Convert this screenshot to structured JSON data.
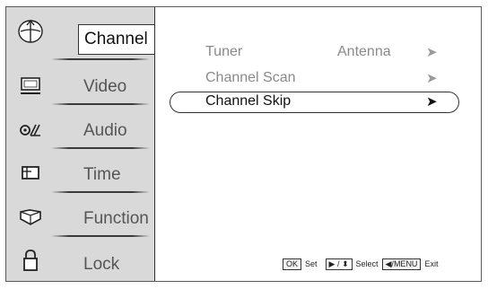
{
  "sidebar": {
    "items": [
      {
        "label": "Channel",
        "icon": "antenna-icon",
        "active": true
      },
      {
        "label": "Video",
        "icon": "monitor-icon"
      },
      {
        "label": "Audio",
        "icon": "audio-icon"
      },
      {
        "label": "Time",
        "icon": "time-icon"
      },
      {
        "label": "Function",
        "icon": "function-icon"
      },
      {
        "label": "Lock",
        "icon": "lock-icon"
      }
    ]
  },
  "menu": {
    "items": [
      {
        "label": "Tuner",
        "value": "Antenna",
        "arrow": "➤"
      },
      {
        "label": "Channel Scan",
        "value": "",
        "arrow": "➤"
      },
      {
        "label": "Channel Skip",
        "value": "",
        "arrow": "➤",
        "selected": true
      }
    ]
  },
  "help_bar": {
    "ok_key": "OK",
    "set_label": "Set",
    "nav_key": "▶ / ⬍",
    "select_label": "Select",
    "menu_key": "◀/MENU",
    "exit_label": "Exit"
  },
  "colors": {
    "sidebar_bg": "#d9d9d9",
    "active_text": "#111111",
    "inactive_text": "#8a8a8a"
  }
}
